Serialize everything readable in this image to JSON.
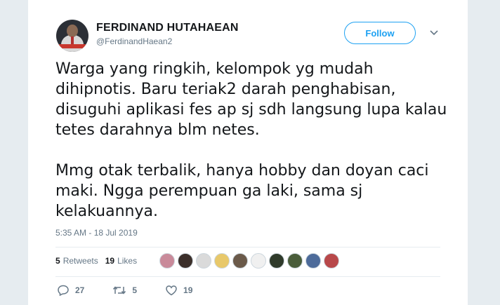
{
  "author": {
    "name": "FERDINAND HUTAHAEAN",
    "handle": "@FerdinandHaean2"
  },
  "follow_label": "Follow",
  "tweet": {
    "paragraph1": "Warga yang ringkih, kelompok yg mudah dihipnotis. Baru teriak2 darah penghabisan, disuguhi aplikasi fes ap sj sdh langsung lupa kalau tetes darahnya blm netes.",
    "paragraph2": "Mmg otak terbalik, hanya hobby dan doyan caci maki. Ngga perempuan ga laki, sama sj kelakuannya.",
    "timestamp": "5:35 AM - 18 Jul 2019"
  },
  "stats": {
    "retweets_count": "5",
    "retweets_label": "Retweets",
    "likes_count": "19",
    "likes_label": "Likes"
  },
  "liker_avatars": [
    "#c98a9a",
    "#3b2f2a",
    "#dadada",
    "#e8c86a",
    "#6b5a4a",
    "#f0f0f0",
    "#2f3a2a",
    "#4a5d3a",
    "#4d6b9a",
    "#b8484a"
  ],
  "actions": {
    "replies": "27",
    "retweets": "5",
    "likes": "19"
  },
  "colors": {
    "accent": "#1da1f2",
    "text": "#14171a",
    "muted": "#657786"
  }
}
